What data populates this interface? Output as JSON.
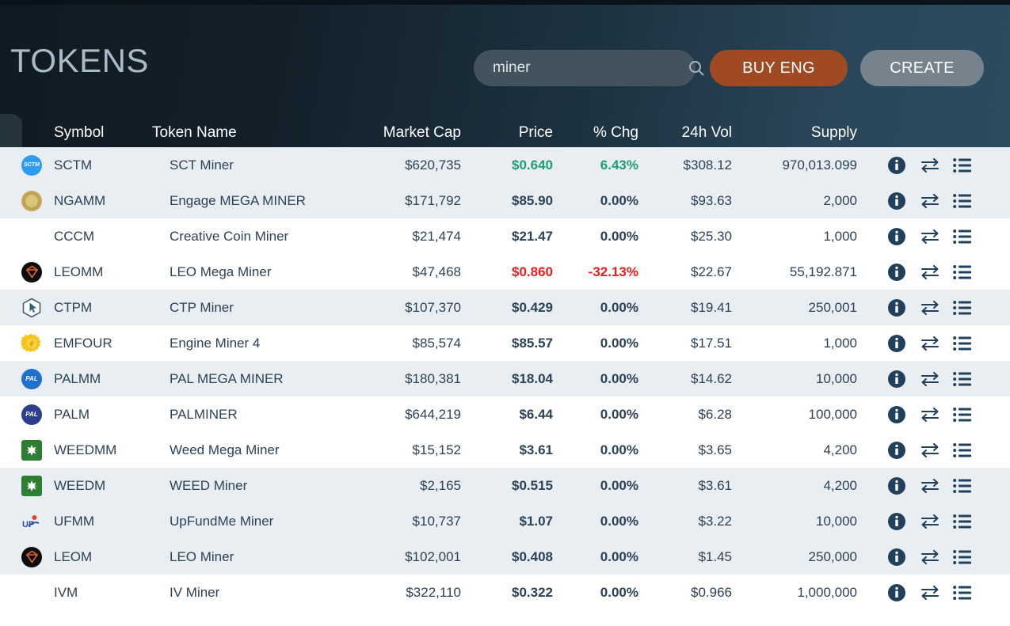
{
  "header": {
    "brand": "TOKENS",
    "search": {
      "value": "miner",
      "placeholder": "Search",
      "icon": "search-icon"
    },
    "buy_button": "BUY ENG",
    "create_button": "CREATE"
  },
  "colors": {
    "header_dark": "#101a22",
    "header_light": "#2d4b5f",
    "buy_button_bg": "#a04a24",
    "create_button_bg": "#76838c",
    "search_bg": "#43535e",
    "row_shaded": "#e9eef2",
    "row_plain": "#ffffff",
    "text": "#2c4257",
    "positive": "#1f9e6e",
    "negative": "#f01b1b"
  },
  "table": {
    "columns": [
      {
        "key": "symbol",
        "label": "Symbol"
      },
      {
        "key": "name",
        "label": "Token Name"
      },
      {
        "key": "market_cap",
        "label": "Market Cap"
      },
      {
        "key": "price",
        "label": "Price"
      },
      {
        "key": "pct_chg",
        "label": "% Chg"
      },
      {
        "key": "vol_24h",
        "label": "24h Vol"
      },
      {
        "key": "supply",
        "label": "Supply"
      }
    ],
    "row_actions": [
      "info-icon",
      "swap-icon",
      "list-icon"
    ],
    "rows": [
      {
        "symbol": "SCTM",
        "name": "SCT Miner",
        "market_cap": "$620,735",
        "price": "$0.640",
        "pct_chg": "6.43%",
        "vol_24h": "$308.12",
        "supply": "970,013.099",
        "chg_dir": "up",
        "shaded": true,
        "icon": "token-icon-sctm",
        "icon_style": "circle",
        "icon_bg": "#2e9cf0",
        "icon_text": "SCTM"
      },
      {
        "symbol": "NGAMM",
        "name": "Engage MEGA MINER",
        "market_cap": "$171,792",
        "price": "$85.90",
        "pct_chg": "0.00%",
        "vol_24h": "$93.63",
        "supply": "2,000",
        "chg_dir": "flat",
        "shaded": true,
        "icon": "token-icon-ngamm",
        "icon_style": "circle",
        "icon_bg": "#c9a94e",
        "icon_text": ""
      },
      {
        "symbol": "CCCM",
        "name": "Creative Coin Miner",
        "market_cap": "$21,474",
        "price": "$21.47",
        "pct_chg": "0.00%",
        "vol_24h": "$25.30",
        "supply": "1,000",
        "chg_dir": "flat",
        "shaded": false,
        "icon": "token-icon-cccm",
        "icon_style": "none",
        "icon_bg": "",
        "icon_text": ""
      },
      {
        "symbol": "LEOMM",
        "name": "LEO Mega Miner",
        "market_cap": "$47,468",
        "price": "$0.860",
        "pct_chg": "-32.13%",
        "vol_24h": "$22.67",
        "supply": "55,192.871",
        "chg_dir": "down",
        "shaded": false,
        "icon": "token-icon-leomm",
        "icon_style": "circle",
        "icon_bg": "#0d0d0d",
        "icon_text": ""
      },
      {
        "symbol": "CTPM",
        "name": "CTP Miner",
        "market_cap": "$107,370",
        "price": "$0.429",
        "pct_chg": "0.00%",
        "vol_24h": "$19.41",
        "supply": "250,001",
        "chg_dir": "flat",
        "shaded": true,
        "icon": "token-icon-ctpm",
        "icon_style": "hex",
        "icon_bg": "#ffffff",
        "icon_text": ""
      },
      {
        "symbol": "EMFOUR",
        "name": "Engine Miner 4",
        "market_cap": "$85,574",
        "price": "$85.57",
        "pct_chg": "0.00%",
        "vol_24h": "$17.51",
        "supply": "1,000",
        "chg_dir": "flat",
        "shaded": false,
        "icon": "token-icon-emfour",
        "icon_style": "gear",
        "icon_bg": "#f5c518",
        "icon_text": ""
      },
      {
        "symbol": "PALMM",
        "name": "PAL MEGA MINER",
        "market_cap": "$180,381",
        "price": "$18.04",
        "pct_chg": "0.00%",
        "vol_24h": "$14.62",
        "supply": "10,000",
        "chg_dir": "flat",
        "shaded": true,
        "icon": "token-icon-palmm",
        "icon_style": "circle",
        "icon_bg": "#1f6fd0",
        "icon_text": "PAL"
      },
      {
        "symbol": "PALM",
        "name": "PALMINER",
        "market_cap": "$644,219",
        "price": "$6.44",
        "pct_chg": "0.00%",
        "vol_24h": "$6.28",
        "supply": "100,000",
        "chg_dir": "flat",
        "shaded": false,
        "icon": "token-icon-palm",
        "icon_style": "circle",
        "icon_bg": "#2b3f8c",
        "icon_text": "PAL"
      },
      {
        "symbol": "WEEDMM",
        "name": "Weed Mega Miner",
        "market_cap": "$15,152",
        "price": "$3.61",
        "pct_chg": "0.00%",
        "vol_24h": "$3.65",
        "supply": "4,200",
        "chg_dir": "flat",
        "shaded": false,
        "icon": "token-icon-weedmm",
        "icon_style": "square",
        "icon_bg": "#2e7d32",
        "icon_text": ""
      },
      {
        "symbol": "WEEDM",
        "name": "WEED Miner",
        "market_cap": "$2,165",
        "price": "$0.515",
        "pct_chg": "0.00%",
        "vol_24h": "$3.61",
        "supply": "4,200",
        "chg_dir": "flat",
        "shaded": true,
        "icon": "token-icon-weedm",
        "icon_style": "square",
        "icon_bg": "#2e7d32",
        "icon_text": ""
      },
      {
        "symbol": "UFMM",
        "name": "UpFundMe Miner",
        "market_cap": "$10,737",
        "price": "$1.07",
        "pct_chg": "0.00%",
        "vol_24h": "$3.22",
        "supply": "10,000",
        "chg_dir": "flat",
        "shaded": true,
        "icon": "token-icon-ufmm",
        "icon_style": "plain",
        "icon_bg": "#ffffff",
        "icon_text": "UF"
      },
      {
        "symbol": "LEOM",
        "name": "LEO Miner",
        "market_cap": "$102,001",
        "price": "$0.408",
        "pct_chg": "0.00%",
        "vol_24h": "$1.45",
        "supply": "250,000",
        "chg_dir": "flat",
        "shaded": true,
        "icon": "token-icon-leom",
        "icon_style": "circle",
        "icon_bg": "#0d0d0d",
        "icon_text": ""
      },
      {
        "symbol": "IVM",
        "name": "IV Miner",
        "market_cap": "$322,110",
        "price": "$0.322",
        "pct_chg": "0.00%",
        "vol_24h": "$0.966",
        "supply": "1,000,000",
        "chg_dir": "flat",
        "shaded": false,
        "icon": "token-icon-ivm",
        "icon_style": "none",
        "icon_bg": "",
        "icon_text": ""
      }
    ]
  }
}
